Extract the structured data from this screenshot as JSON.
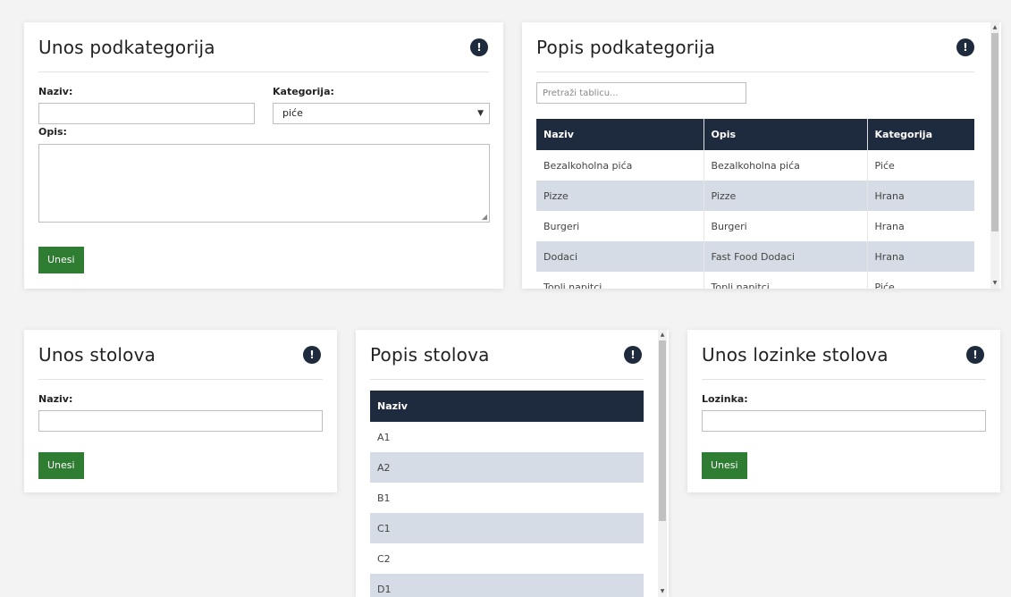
{
  "subcategory_form": {
    "title": "Unos podkategorija",
    "info_icon": "!",
    "name_label": "Naziv:",
    "name_value": "",
    "category_label": "Kategorija:",
    "category_selected": "piće",
    "description_label": "Opis:",
    "submit_label": "Unesi"
  },
  "subcategory_list": {
    "title": "Popis podkategorija",
    "info_icon": "!",
    "search_placeholder": "Pretraži tablicu...",
    "columns": [
      "Naziv",
      "Opis",
      "Kategorija"
    ],
    "rows": [
      [
        "Bezalkoholna pića",
        "Bezalkoholna pića",
        "Piće"
      ],
      [
        "Pizze",
        "Pizze",
        "Hrana"
      ],
      [
        "Burgeri",
        "Burgeri",
        "Hrana"
      ],
      [
        "Dodaci",
        "Fast Food Dodaci",
        "Hrana"
      ],
      [
        "Topli napitci",
        "Topli napitci",
        "Piće"
      ]
    ]
  },
  "table_form": {
    "title": "Unos stolova",
    "info_icon": "!",
    "name_label": "Naziv:",
    "submit_label": "Unesi"
  },
  "table_list": {
    "title": "Popis stolova",
    "info_icon": "!",
    "columns": [
      "Naziv"
    ],
    "rows": [
      "A1",
      "A2",
      "B1",
      "C1",
      "C2",
      "D1"
    ]
  },
  "password_form": {
    "title": "Unos lozinke stolova",
    "info_icon": "!",
    "password_label": "Lozinka:",
    "submit_label": "Unesi"
  },
  "colors": {
    "header_dark": "#1e2a3e",
    "button_green": "#2e7d32",
    "row_alt": "#d6dce5"
  }
}
